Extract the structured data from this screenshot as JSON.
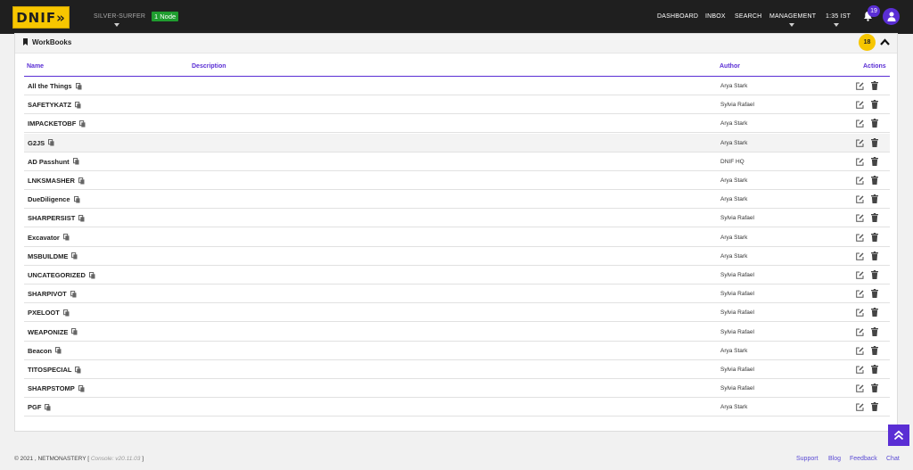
{
  "header": {
    "logo": "DNIF»",
    "instance": "SILVER-SURFER",
    "node_badge": "1 Node",
    "nav": [
      "DASHBOARD",
      "INBOX",
      "SEARCH",
      "MANAGEMENT",
      "1:35 IST"
    ],
    "notification_count": "19"
  },
  "panel": {
    "title": "WorkBooks",
    "count": "18",
    "columns": {
      "name": "Name",
      "description": "Description",
      "author": "Author",
      "actions": "Actions"
    },
    "rows": [
      {
        "name": "All the Things",
        "description": "",
        "author": "Arya Stark"
      },
      {
        "name": "SAFETYKATZ",
        "description": "",
        "author": "Sylvia Rafael"
      },
      {
        "name": "IMPACKETOBF",
        "description": "",
        "author": "Arya Stark"
      },
      {
        "name": "G2JS",
        "description": "",
        "author": "Arya Stark"
      },
      {
        "name": "AD Passhunt",
        "description": "",
        "author": "DNIF HQ"
      },
      {
        "name": "LNKSMASHER",
        "description": "",
        "author": "Arya Stark"
      },
      {
        "name": "DueDiligence",
        "description": "",
        "author": "Arya Stark"
      },
      {
        "name": "SHARPERSIST",
        "description": "",
        "author": "Sylvia Rafael"
      },
      {
        "name": "Excavator",
        "description": "",
        "author": "Arya Stark"
      },
      {
        "name": "MSBUILDME",
        "description": "",
        "author": "Arya Stark"
      },
      {
        "name": "UNCATEGORIZED",
        "description": "",
        "author": "Sylvia Rafael"
      },
      {
        "name": "SHARPIVOT",
        "description": "",
        "author": "Sylvia Rafael"
      },
      {
        "name": "PXELOOT",
        "description": "",
        "author": "Sylvia Rafael"
      },
      {
        "name": "WEAPONIZE",
        "description": "",
        "author": "Sylvia Rafael"
      },
      {
        "name": "Beacon",
        "description": "",
        "author": "Arya Stark"
      },
      {
        "name": "TITOSPECIAL",
        "description": "",
        "author": "Sylvia Rafael"
      },
      {
        "name": "SHARPSTOMP",
        "description": "",
        "author": "Sylvia Rafael"
      },
      {
        "name": "PGF",
        "description": "",
        "author": "Arya Stark"
      }
    ],
    "highlighted_row": 3
  },
  "footer": {
    "copyright": "© 2021 , NETMONASTERY [",
    "version": "Console: v20.11.03",
    "bracket_close": "]",
    "links": [
      "Support",
      "Blog",
      "Feedback",
      "Chat"
    ]
  },
  "icons": {
    "bell": "bell-icon",
    "user": "user-icon",
    "bookmark": "bookmark-icon",
    "collapse": "chevron-up-icon",
    "copy": "copy-icon",
    "edit": "edit-icon",
    "delete": "trash-icon",
    "scroll_top": "double-chevron-up-icon"
  },
  "colors": {
    "accent": "#5a2ed4",
    "brand": "#f7c600",
    "node_badge": "#1f9d2f",
    "topbar": "#1f1f1f"
  }
}
